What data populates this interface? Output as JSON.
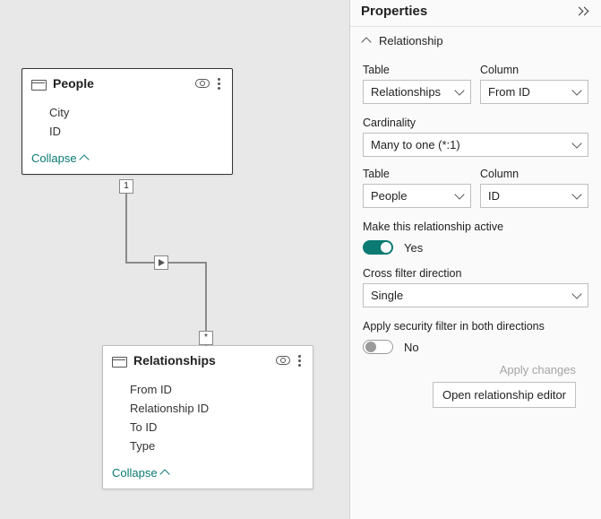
{
  "canvas": {
    "tables": {
      "people": {
        "name": "People",
        "fields": [
          "City",
          "ID"
        ],
        "collapse_label": "Collapse"
      },
      "relationships": {
        "name": "Relationships",
        "fields": [
          "From ID",
          "Relationship ID",
          "To ID",
          "Type"
        ],
        "collapse_label": "Collapse"
      }
    },
    "edge": {
      "from_marker": "1",
      "to_marker": "*"
    }
  },
  "panel": {
    "title": "Properties",
    "section": "Relationship",
    "labels": {
      "table": "Table",
      "column": "Column",
      "cardinality": "Cardinality",
      "make_active": "Make this relationship active",
      "cross_filter": "Cross filter direction",
      "apply_sec": "Apply security filter in both directions"
    },
    "values": {
      "table1": "Relationships",
      "column1": "From ID",
      "cardinality": "Many to one (*:1)",
      "table2": "People",
      "column2": "ID",
      "active_text": "Yes",
      "cross_filter": "Single",
      "apply_sec_text": "No"
    },
    "footer": {
      "apply_changes": "Apply changes",
      "open_editor": "Open relationship editor"
    }
  }
}
